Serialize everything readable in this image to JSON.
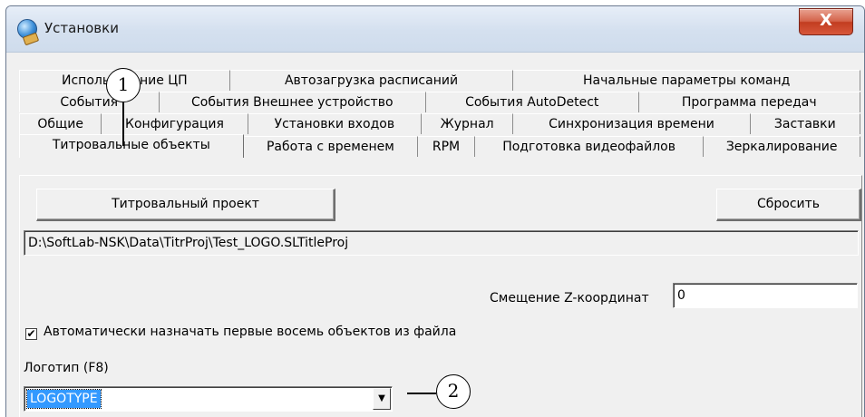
{
  "window": {
    "title": "Установки",
    "close_glyph": "X"
  },
  "tabs": {
    "row1": [
      "Использование ЦП",
      "Автозагрузка расписаний",
      "Начальные параметры команд"
    ],
    "row2": [
      "События",
      "События Внешнее устройство",
      "События AutoDetect",
      "Программа передач"
    ],
    "row3": [
      "Общие",
      "Конфигурация",
      "Установки входов",
      "Журнал",
      "Синхронизация времени",
      "Заставки"
    ],
    "row4": [
      "Титровальные объекты",
      "Работа с временем",
      "RPM",
      "Подготовка видеофайлов",
      "Зеркалирование"
    ],
    "active": "Титровальные объекты"
  },
  "panel": {
    "project_button": "Титровальный проект",
    "reset_button": "Сбросить",
    "project_path": "D:\\SoftLab-NSK\\Data\\TitrProj\\Test_LOGO.SLTitleProj",
    "z_offset_label": "Смещение Z-координат",
    "z_offset_value": "0",
    "auto_assign_label": "Автоматически назначать первые восемь объектов из файла",
    "auto_assign_checked": true,
    "check_glyph": "✔",
    "logo_label": "Логотип (F8)",
    "logo_value": "LOGOTYPE",
    "dropdown_arrow": "▼"
  },
  "callouts": [
    "1",
    "2"
  ]
}
